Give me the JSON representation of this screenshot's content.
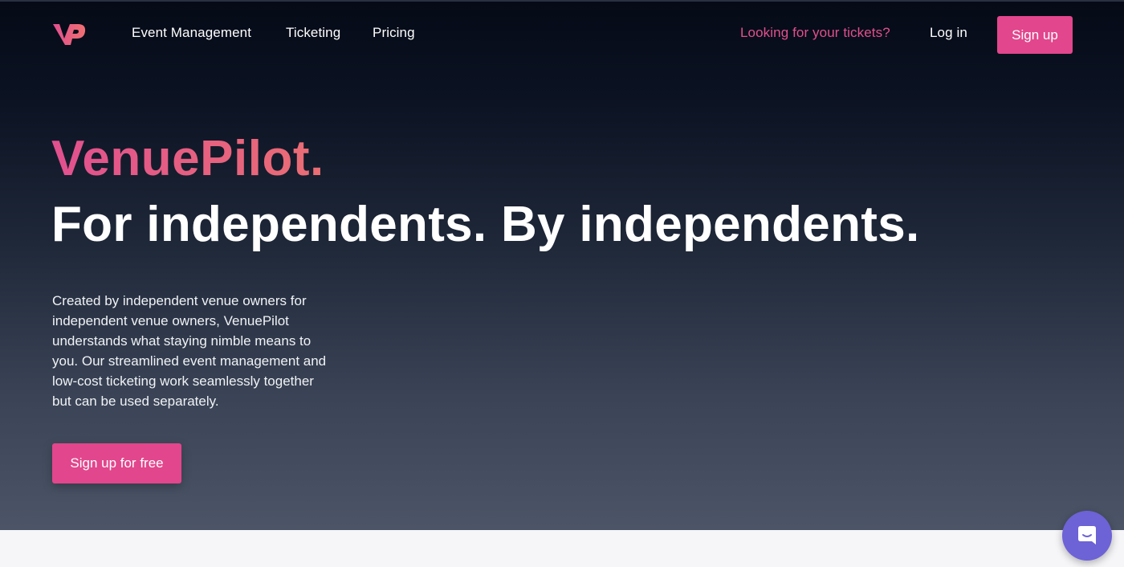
{
  "colors": {
    "accent": "#e2468c",
    "brand_pink": "#e1508f",
    "hero_dark": "#050a16",
    "hero_light": "#4c5567",
    "chat": "#6d62d6"
  },
  "nav": {
    "logo_icon": "vp-logo-icon",
    "links": [
      "Event Management",
      "Ticketing",
      "Pricing"
    ],
    "tickets_link": "Looking for your tickets?",
    "login": "Log in",
    "signup": "Sign up"
  },
  "hero": {
    "brand": "VenuePilot.",
    "headline": "For independents. By independents.",
    "description": "Created by independent venue owners for independent venue owners, VenuePilot understands what staying nimble means to you. Our streamlined event management and low-cost ticketing work seamlessly together but can be used separately.",
    "cta": "Sign up for free"
  },
  "chat": {
    "icon": "chat-bubble-icon"
  }
}
